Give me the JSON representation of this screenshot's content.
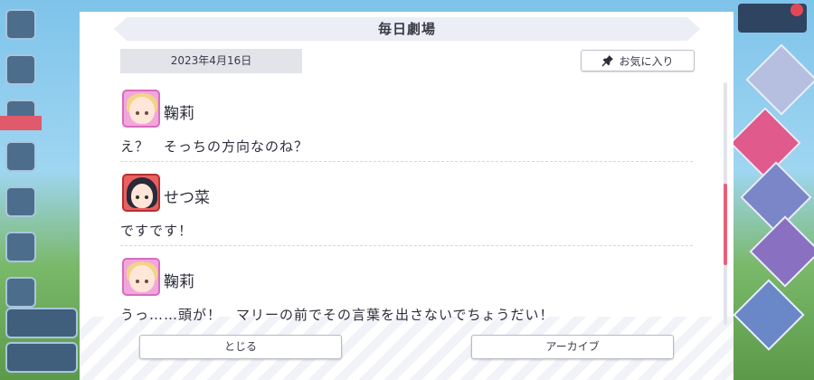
{
  "dialog": {
    "title": "毎日劇場",
    "date": "2023年4月16日",
    "favorite_label": "お気に入り"
  },
  "entries": [
    {
      "speaker": "鞠莉",
      "line": "え？　そっちの方向なのね？"
    },
    {
      "speaker": "せつ菜",
      "line": "ですです！"
    },
    {
      "speaker": "鞠莉",
      "line": "うっ……頭が！　マリーの前でその言葉を出さないでちょうだい！"
    }
  ],
  "buttons": {
    "close_label": "とじる",
    "archive_label": "アーカイブ"
  },
  "colors": {
    "scroll_thumb": "#e8607a",
    "mari_avatar_bg": "#f2a6dc",
    "setsuna_avatar_bg": "#e86060"
  },
  "icons": {
    "favorite": "pin-icon"
  }
}
